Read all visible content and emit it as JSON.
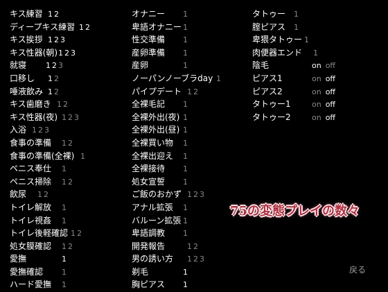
{
  "columns": [
    [
      {
        "label": "キス練習",
        "values": [
          {
            "t": "1",
            "on": true
          },
          {
            "t": "2",
            "on": true
          }
        ]
      },
      {
        "label": "ディープキス練習",
        "values": [
          {
            "t": "1",
            "on": true
          },
          {
            "t": "2",
            "on": true
          }
        ]
      },
      {
        "label": "キス挨拶",
        "values": [
          {
            "t": "1",
            "on": true
          },
          {
            "t": "2",
            "on": true
          },
          {
            "t": "3",
            "on": true
          }
        ]
      },
      {
        "label": "キス性器(朝)",
        "values": [
          {
            "t": "1",
            "on": true
          },
          {
            "t": "2",
            "on": true
          },
          {
            "t": "3",
            "on": true
          }
        ]
      },
      {
        "label": "就寝",
        "values": [
          {
            "t": "1",
            "on": true
          },
          {
            "t": "2",
            "on": true
          },
          {
            "t": "3",
            "on": false
          }
        ]
      },
      {
        "label": "口移し",
        "values": [
          {
            "t": "1",
            "on": true
          },
          {
            "t": "2",
            "on": false
          }
        ]
      },
      {
        "label": "唾液飲み",
        "values": [
          {
            "t": "1",
            "on": true
          },
          {
            "t": "2",
            "on": false
          }
        ]
      },
      {
        "label": "キス歯磨き",
        "values": [
          {
            "t": "1",
            "on": false
          },
          {
            "t": "2",
            "on": false
          }
        ]
      },
      {
        "label": "キス性器(夜)",
        "values": [
          {
            "t": "1",
            "on": false
          },
          {
            "t": "2",
            "on": false
          },
          {
            "t": "3",
            "on": false
          }
        ]
      },
      {
        "label": "入浴",
        "values": [
          {
            "t": "1",
            "on": false
          },
          {
            "t": "2",
            "on": false
          },
          {
            "t": "3",
            "on": false
          }
        ]
      },
      {
        "label": "食事の準備",
        "values": [
          {
            "t": "1",
            "on": false
          },
          {
            "t": "2",
            "on": false
          }
        ]
      },
      {
        "label": "食事の準備(全裸)",
        "values": [
          {
            "t": "1",
            "on": false
          }
        ]
      },
      {
        "label": "ペニス奉仕",
        "values": [
          {
            "t": "1",
            "on": false
          }
        ]
      },
      {
        "label": "ペニス掃除",
        "values": [
          {
            "t": "1",
            "on": false
          },
          {
            "t": "2",
            "on": false
          }
        ]
      },
      {
        "label": "飲尿",
        "values": [
          {
            "t": "1",
            "on": false
          },
          {
            "t": "2",
            "on": false
          }
        ]
      },
      {
        "label": "トイレ解放",
        "values": [
          {
            "t": "1",
            "on": false
          }
        ]
      },
      {
        "label": "トイレ視姦",
        "values": [
          {
            "t": "1",
            "on": false
          }
        ]
      },
      {
        "label": "トイレ後軽確認",
        "values": [
          {
            "t": "1",
            "on": false
          },
          {
            "t": "2",
            "on": false
          }
        ]
      },
      {
        "label": "処女膜確認",
        "values": [
          {
            "t": "1",
            "on": false
          },
          {
            "t": "2",
            "on": false
          }
        ]
      },
      {
        "label": "愛撫",
        "values": [
          {
            "t": "1",
            "on": true
          }
        ]
      },
      {
        "label": "愛撫確認",
        "values": [
          {
            "t": "1",
            "on": false
          }
        ]
      },
      {
        "label": "ハード愛撫",
        "values": [
          {
            "t": "1",
            "on": false
          }
        ]
      }
    ],
    [
      {
        "label": "オナニー",
        "values": [
          {
            "t": "1",
            "on": false
          }
        ]
      },
      {
        "label": "卑語オナニー",
        "values": [
          {
            "t": "1",
            "on": false
          }
        ]
      },
      {
        "label": "性交準備",
        "values": [
          {
            "t": "1",
            "on": false
          }
        ]
      },
      {
        "label": "産卵準備",
        "values": [
          {
            "t": "1",
            "on": false
          }
        ]
      },
      {
        "label": "産卵",
        "values": [
          {
            "t": "1",
            "on": false
          }
        ]
      },
      {
        "label": "ノーパンノーブラday",
        "values": [
          {
            "t": "1",
            "on": false
          }
        ]
      },
      {
        "label": "パイプデート",
        "values": [
          {
            "t": "1",
            "on": false
          },
          {
            "t": "2",
            "on": false
          }
        ]
      },
      {
        "label": "全裸毛記",
        "values": [
          {
            "t": "1",
            "on": false
          }
        ]
      },
      {
        "label": "全裸外出(夜)",
        "values": [
          {
            "t": "1",
            "on": false
          }
        ]
      },
      {
        "label": "全裸外出(昼)",
        "values": [
          {
            "t": "1",
            "on": false
          }
        ]
      },
      {
        "label": "全裸買い物",
        "values": [
          {
            "t": "1",
            "on": false
          }
        ]
      },
      {
        "label": "全裸出迎え",
        "values": [
          {
            "t": "1",
            "on": false
          }
        ]
      },
      {
        "label": "全裸接待",
        "values": [
          {
            "t": "1",
            "on": false
          }
        ]
      },
      {
        "label": "処女宣誓",
        "values": [
          {
            "t": "1",
            "on": false
          }
        ]
      },
      {
        "label": "ご飯のおかず",
        "values": [
          {
            "t": "1",
            "on": false
          },
          {
            "t": "2",
            "on": false
          },
          {
            "t": "3",
            "on": false
          }
        ]
      },
      {
        "label": "アナル拡張",
        "values": [
          {
            "t": "1",
            "on": false
          }
        ]
      },
      {
        "label": "バルーン拡張",
        "values": [
          {
            "t": "1",
            "on": false
          }
        ]
      },
      {
        "label": "卑語調教",
        "values": [
          {
            "t": "1",
            "on": false
          }
        ]
      },
      {
        "label": "開発報告",
        "values": [
          {
            "t": "1",
            "on": false
          },
          {
            "t": "2",
            "on": false
          }
        ]
      },
      {
        "label": "男の誘い方",
        "values": [
          {
            "t": "1",
            "on": false
          },
          {
            "t": "2",
            "on": false
          },
          {
            "t": "3",
            "on": false
          }
        ]
      },
      {
        "label": "剃毛",
        "values": [
          {
            "t": "1",
            "on": true
          }
        ]
      },
      {
        "label": "胸ピアス",
        "values": [
          {
            "t": "1",
            "on": true
          }
        ]
      }
    ],
    [
      {
        "label": "タトゥー",
        "values": [
          {
            "t": "1",
            "on": false
          }
        ]
      },
      {
        "label": "腟ピアス",
        "values": [
          {
            "t": "1",
            "on": false
          }
        ]
      },
      {
        "label": "卑猥タトゥー",
        "values": [
          {
            "t": "1",
            "on": false
          }
        ]
      },
      {
        "label": "肉便器エンド",
        "values": [
          {
            "t": "1",
            "on": false
          }
        ]
      },
      {
        "label": "陰毛",
        "toggle": {
          "on": "on",
          "off": "off",
          "state": "on"
        }
      },
      {
        "label": "ピアス1",
        "toggle": {
          "on": "on",
          "off": "off",
          "state": "off"
        }
      },
      {
        "label": "ピアス2",
        "toggle": {
          "on": "on",
          "off": "off",
          "state": "off"
        }
      },
      {
        "label": "タトゥー1",
        "toggle": {
          "on": "on",
          "off": "off",
          "state": "off"
        }
      },
      {
        "label": "タトゥー2",
        "toggle": {
          "on": "on",
          "off": "off",
          "state": "off"
        }
      }
    ]
  ],
  "title": "75の変態プレイの数々",
  "back_label": "戻る",
  "colors": {
    "active": "#ffffff",
    "inactive": "#8a8a8a",
    "title": "#b03040",
    "background": "#000000"
  }
}
